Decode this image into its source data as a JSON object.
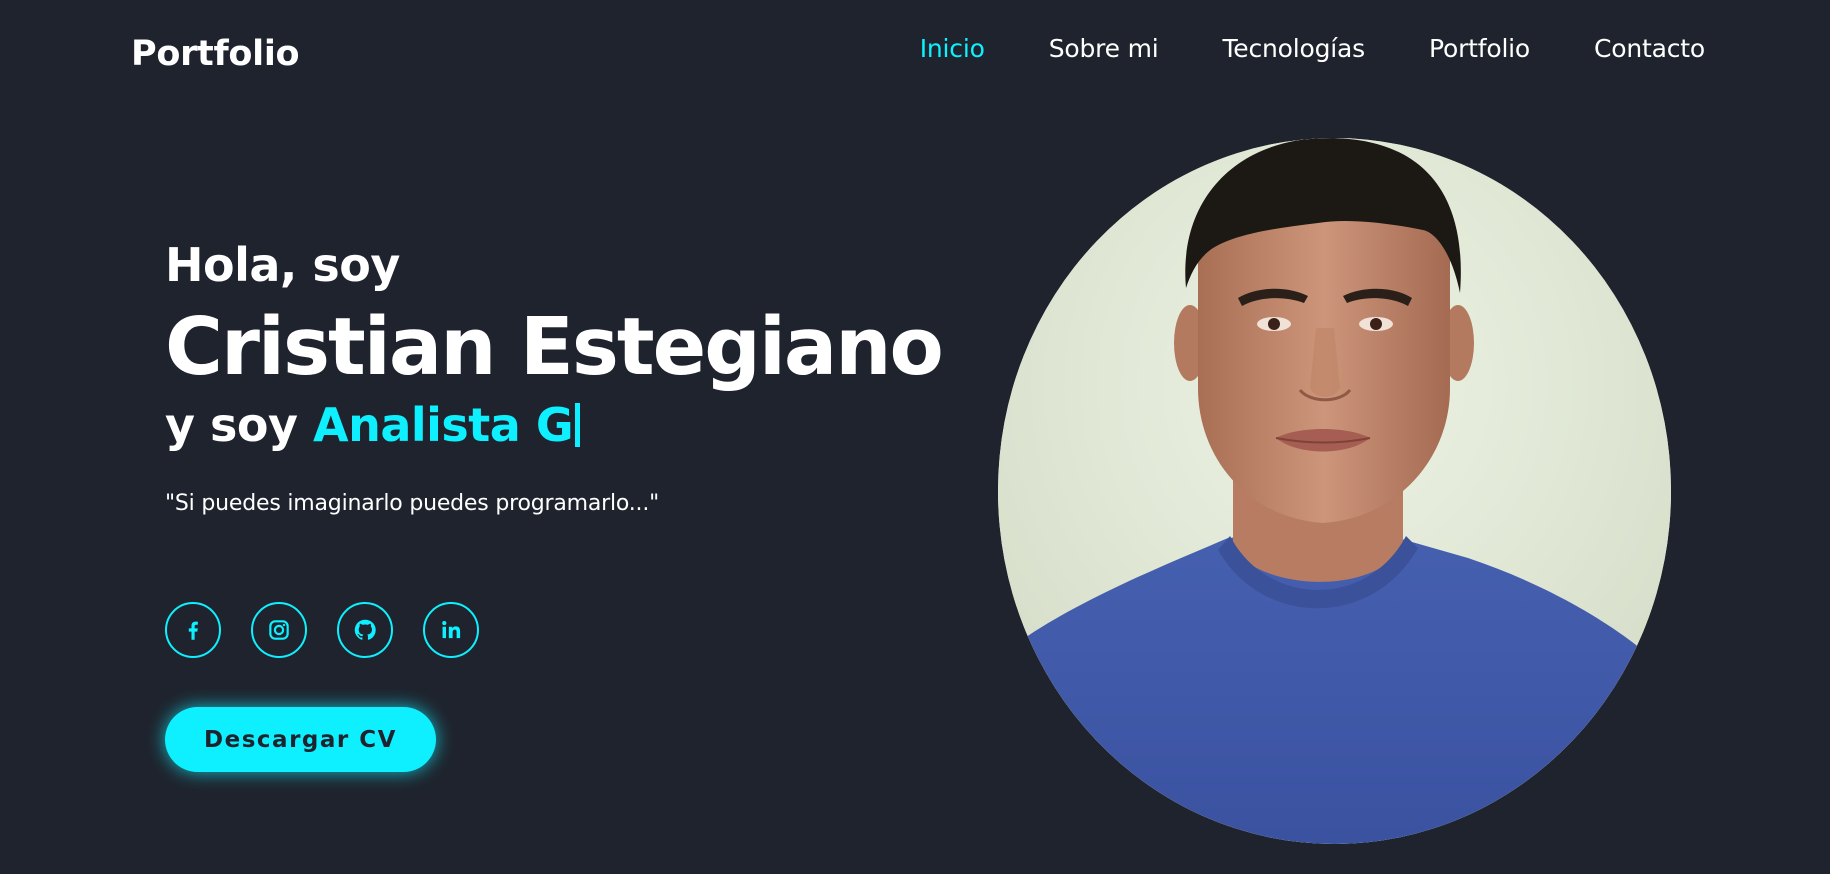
{
  "header": {
    "logo": "Portfolio",
    "nav": [
      {
        "label": "Inicio",
        "active": true
      },
      {
        "label": "Sobre mi",
        "active": false
      },
      {
        "label": "Tecnologías",
        "active": false
      },
      {
        "label": "Portfolio",
        "active": false
      },
      {
        "label": "Contacto",
        "active": false
      }
    ]
  },
  "hero": {
    "greeting": "Hola, soy",
    "name": "Cristian Estegiano",
    "role_prefix": "y soy",
    "role_typed": "Analista G",
    "quote": "\"Si puedes imaginarlo puedes programarlo...\"",
    "cv_button": "Descargar CV"
  },
  "socials": [
    {
      "icon": "facebook-icon"
    },
    {
      "icon": "instagram-icon"
    },
    {
      "icon": "github-icon"
    },
    {
      "icon": "linkedin-icon"
    }
  ],
  "colors": {
    "background": "#1f232d",
    "accent": "#0ef0ff",
    "text": "#ffffff"
  }
}
